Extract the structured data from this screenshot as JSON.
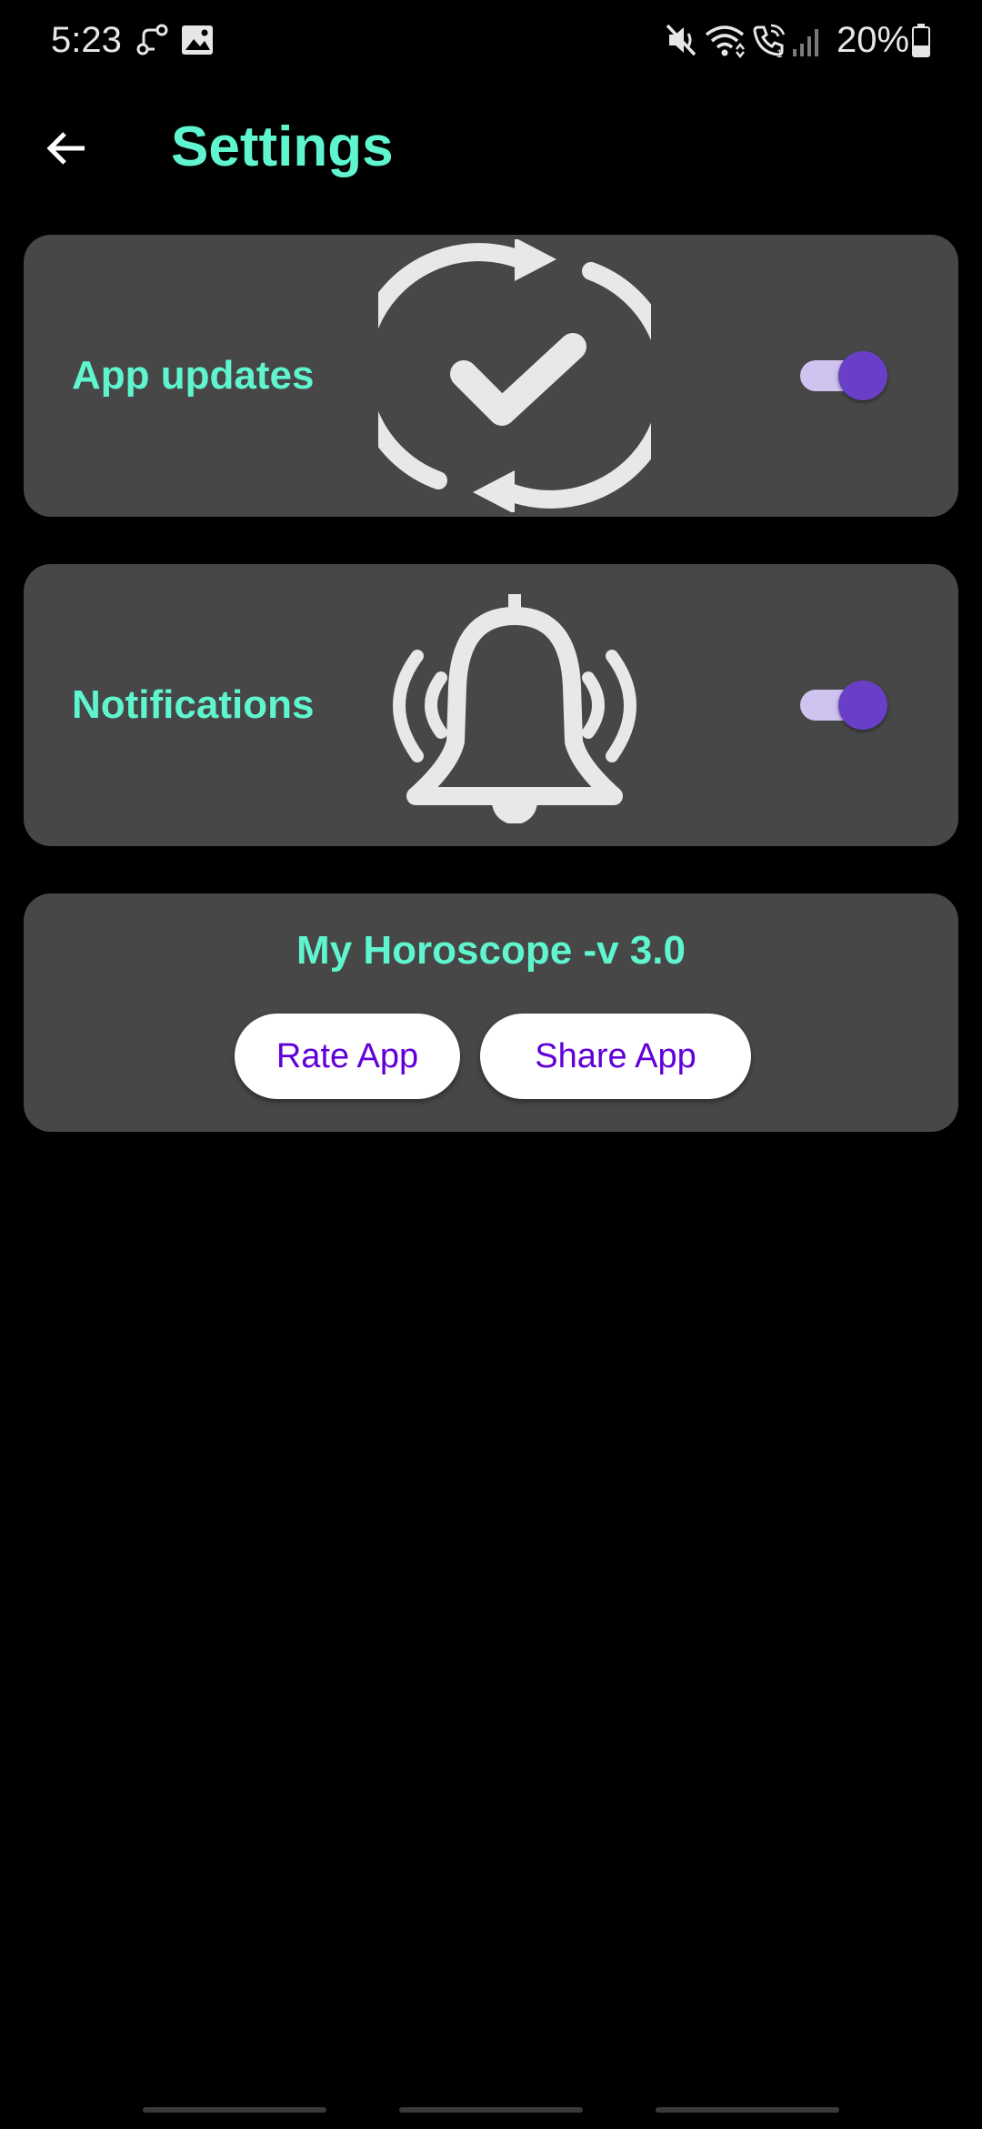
{
  "status_bar": {
    "time": "5:23",
    "battery": "20%",
    "icons": [
      "link-icon",
      "image-icon",
      "mute-icon",
      "wifi-icon",
      "wifi-call-icon",
      "signal-icon",
      "battery-icon"
    ]
  },
  "app_bar": {
    "title": "Settings",
    "back_icon": "arrow-left-icon"
  },
  "settings": {
    "app_updates": {
      "label": "App updates",
      "icon": "sync-check-icon",
      "enabled": true
    },
    "notifications": {
      "label": "Notifications",
      "icon": "ringing-bell-icon",
      "enabled": true
    }
  },
  "about": {
    "title": "My Horoscope -v 3.0",
    "rate_label": "Rate App",
    "share_label": "Share App"
  },
  "colors": {
    "accent": "#5ef5cf",
    "card_background": "#474747",
    "toggle_thumb": "#6a3fc8",
    "toggle_track": "#cfc3ef",
    "button_text": "#6200d8",
    "background": "#000000"
  }
}
